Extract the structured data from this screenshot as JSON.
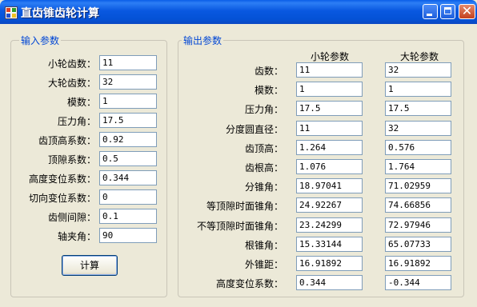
{
  "window": {
    "title": "直齿锥齿轮计算"
  },
  "input_group": {
    "title": "输入参数",
    "fields": [
      {
        "label": "小轮齿数：",
        "value": "11"
      },
      {
        "label": "大轮齿数：",
        "value": "32"
      },
      {
        "label": "模数：",
        "value": "1"
      },
      {
        "label": "压力角：",
        "value": "17.5"
      },
      {
        "label": "齿顶高系数：",
        "value": "0.92"
      },
      {
        "label": "顶隙系数：",
        "value": "0.5"
      },
      {
        "label": "高度变位系数：",
        "value": "0.344"
      },
      {
        "label": "切向变位系数：",
        "value": "0"
      },
      {
        "label": "齿侧间隙：",
        "value": "0.1"
      },
      {
        "label": "轴夹角：",
        "value": "90"
      }
    ],
    "calc_button": "计算"
  },
  "output_group": {
    "title": "输出参数",
    "col_small": "小轮参数",
    "col_large": "大轮参数",
    "rows": [
      {
        "label": "齿数：",
        "small": "11",
        "large": "32"
      },
      {
        "label": "模数：",
        "small": "1",
        "large": "1"
      },
      {
        "label": "压力角：",
        "small": "17.5",
        "large": "17.5"
      },
      {
        "label": "分度圆直径：",
        "small": "11",
        "large": "32"
      },
      {
        "label": "齿顶高：",
        "small": "1.264",
        "large": "0.576"
      },
      {
        "label": "齿根高：",
        "small": "1.076",
        "large": "1.764"
      },
      {
        "label": "分锥角：",
        "small": "18.97041",
        "large": "71.02959"
      },
      {
        "label": "等顶隙时面锥角：",
        "small": "24.92267",
        "large": "74.66856"
      },
      {
        "label": "不等顶隙时面锥角：",
        "small": "23.24299",
        "large": "72.97946"
      },
      {
        "label": "根锥角：",
        "small": "15.33144",
        "large": "65.07733"
      },
      {
        "label": "外锥距：",
        "small": "16.91892",
        "large": "16.91892"
      },
      {
        "label": "高度变位系数：",
        "small": "0.344",
        "large": "-0.344"
      }
    ]
  }
}
